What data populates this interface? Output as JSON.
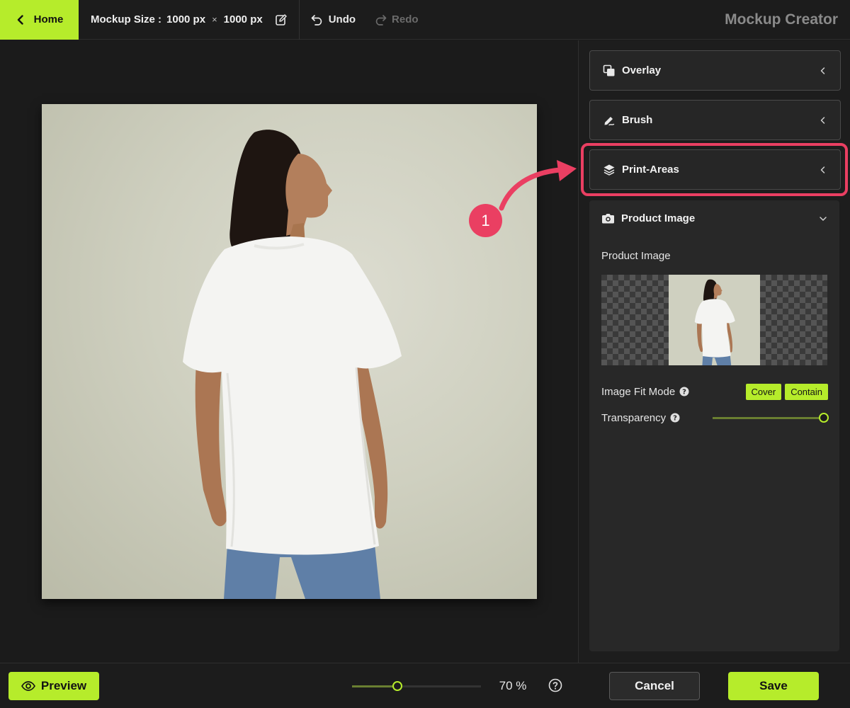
{
  "header": {
    "home_label": "Home",
    "size_label": "Mockup Size :",
    "width": "1000 px",
    "times": "×",
    "height": "1000 px",
    "undo_label": "Undo",
    "redo_label": "Redo",
    "app_title": "Mockup Creator"
  },
  "panel": {
    "sections": {
      "overlay": "Overlay",
      "brush": "Brush",
      "print_areas": "Print-Areas",
      "product_image": "Product Image"
    },
    "product_image_label": "Product Image",
    "fit_mode_label": "Image Fit Mode",
    "fit_options": {
      "cover": "Cover",
      "contain": "Contain"
    },
    "transparency_label": "Transparency",
    "transparency_value": 1.0
  },
  "annotation": {
    "step": "1",
    "color": "#ea3f62"
  },
  "footer": {
    "preview_label": "Preview",
    "zoom_value": 0.35,
    "zoom_readout": "70 %",
    "cancel_label": "Cancel",
    "save_label": "Save"
  },
  "colors": {
    "accent": "#b6ec2b",
    "highlight": "#ea3f62",
    "background": "#1b1b1b"
  },
  "icons": {
    "back": "chevron-left-icon",
    "edit": "edit-icon",
    "undo": "undo-icon",
    "redo": "redo-icon",
    "overlay": "overlay-icon",
    "brush": "brush-icon",
    "print_areas": "layers-icon",
    "product_image": "camera-icon",
    "help": "help-icon",
    "preview": "eye-icon"
  }
}
